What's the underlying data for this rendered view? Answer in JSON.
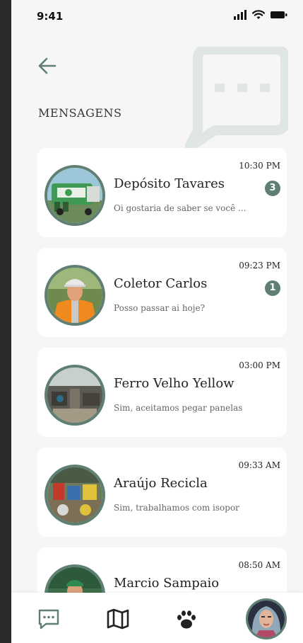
{
  "status_bar": {
    "time": "9:41"
  },
  "header": {
    "title": "MENSAGENS"
  },
  "conversations": [
    {
      "name": "Depósito Tavares",
      "preview": "Oi gostaria de saber se você ...",
      "time": "10:30 PM",
      "unread": "3"
    },
    {
      "name": "Coletor Carlos",
      "preview": "Posso passar ai hoje?",
      "time": "09:23 PM",
      "unread": "1"
    },
    {
      "name": "Ferro Velho Yellow",
      "preview": "Sim, aceitamos pegar panelas",
      "time": "03:00 PM",
      "unread": ""
    },
    {
      "name": "Araújo Recicla",
      "preview": "Sim, trabalhamos com isopor",
      "time": "09:33 AM",
      "unread": ""
    },
    {
      "name": "Marcio Sampaio",
      "preview": "",
      "time": "08:50 AM",
      "unread": ""
    }
  ],
  "nav": {
    "items": [
      "chat-icon",
      "map-icon",
      "paw-icon",
      "profile-avatar"
    ]
  },
  "colors": {
    "accent": "#5e7f72",
    "background": "#f6f6f6",
    "card": "#ffffff",
    "deco": "#dfe6e3"
  }
}
